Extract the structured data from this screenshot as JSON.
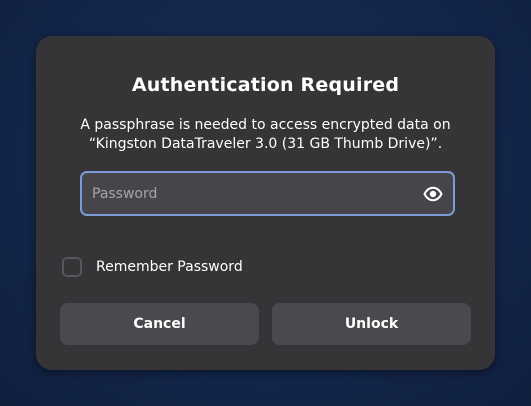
{
  "dialog": {
    "title": "Authentication Required",
    "message": "A passphrase is needed to access encrypted data on “Kingston DataTraveler 3.0 (31 GB Thumb Drive)”.",
    "password": {
      "placeholder": "Password",
      "value": "",
      "reveal_icon": "eye-icon"
    },
    "remember": {
      "label": "Remember Password",
      "checked": false
    },
    "buttons": {
      "cancel": "Cancel",
      "unlock": "Unlock"
    }
  },
  "colors": {
    "background": "#13264a",
    "dialog": "#353537",
    "field": "#46464a",
    "focus_border": "#7d9bd4",
    "button": "#4a4a4e"
  }
}
